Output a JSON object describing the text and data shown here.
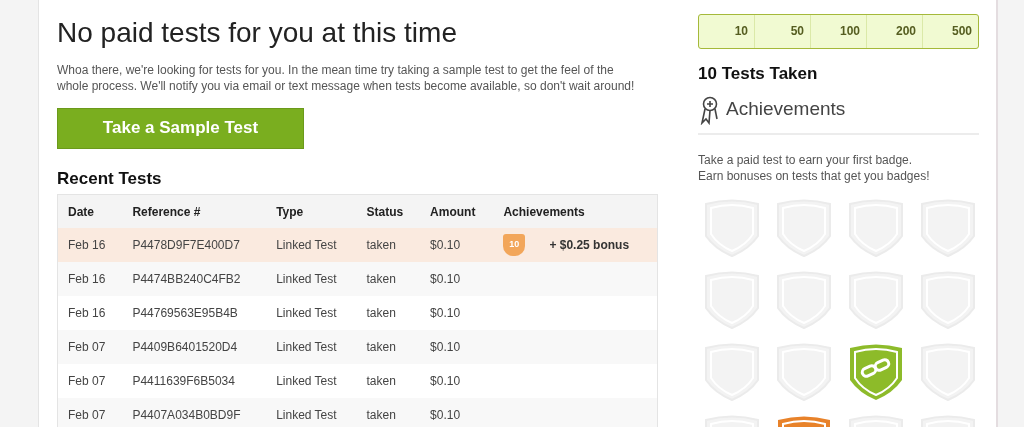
{
  "main": {
    "title": "No paid tests for you at this time",
    "message": "Whoa there, we're looking for tests for you. In the mean time try taking a sample test to get the feel of the whole process. We'll notify you via email or text message when tests become available, so don't wait around!",
    "sample_button": "Take a Sample Test",
    "recent_title": "Recent Tests",
    "table": {
      "columns": [
        "Date",
        "Reference #",
        "Type",
        "Status",
        "Amount",
        "Achievements"
      ],
      "rows": [
        {
          "date": "Feb 16",
          "reference": "P4478D9F7E400D7",
          "type": "Linked Test",
          "status": "taken",
          "amount": "$0.10",
          "achievement": {
            "badge": "10",
            "bonus": "+ $0.25 bonus"
          }
        },
        {
          "date": "Feb 16",
          "reference": "P4474BB240C4FB2",
          "type": "Linked Test",
          "status": "taken",
          "amount": "$0.10"
        },
        {
          "date": "Feb 16",
          "reference": "P44769563E95B4B",
          "type": "Linked Test",
          "status": "taken",
          "amount": "$0.10"
        },
        {
          "date": "Feb 07",
          "reference": "P4409B6401520D4",
          "type": "Linked Test",
          "status": "taken",
          "amount": "$0.10"
        },
        {
          "date": "Feb 07",
          "reference": "P4411639F6B5034",
          "type": "Linked Test",
          "status": "taken",
          "amount": "$0.10"
        },
        {
          "date": "Feb 07",
          "reference": "P4407A034B0BD9F",
          "type": "Linked Test",
          "status": "taken",
          "amount": "$0.10"
        }
      ]
    }
  },
  "sidebar": {
    "milestones": [
      "10",
      "50",
      "100",
      "200",
      "500"
    ],
    "tests_taken": "10 Tests Taken",
    "achievements_title": "Achievements",
    "hint": [
      "Take a paid test to earn your first badge.",
      "Earn bonuses on tests that get you badges!"
    ],
    "badges": [
      {
        "earned": false
      },
      {
        "earned": false
      },
      {
        "earned": false
      },
      {
        "earned": false
      },
      {
        "earned": false
      },
      {
        "earned": false
      },
      {
        "earned": false
      },
      {
        "earned": false
      },
      {
        "earned": false
      },
      {
        "earned": false
      },
      {
        "earned": true,
        "color": "#8dbb2a"
      },
      {
        "earned": false
      },
      {
        "earned": false
      },
      {
        "earned": true,
        "color": "#e8822a"
      },
      {
        "earned": false
      },
      {
        "earned": false
      }
    ]
  }
}
